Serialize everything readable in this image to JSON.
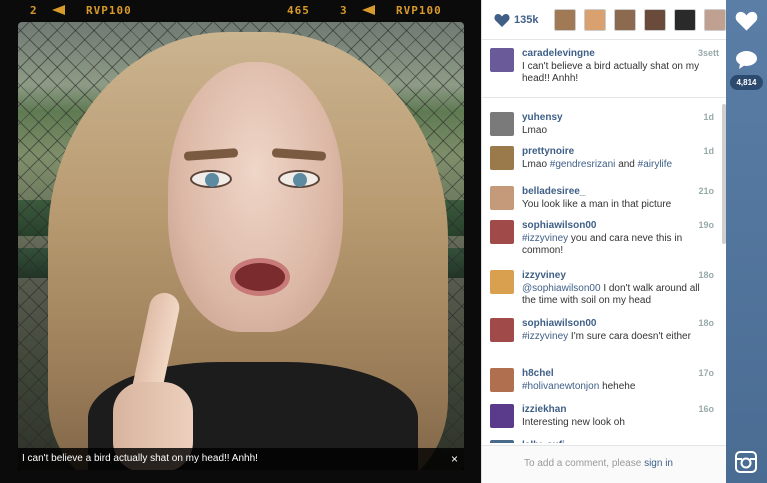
{
  "film_strip": {
    "left_frame": "2",
    "left_brand": "RVP100",
    "center_number": "465",
    "right_frame": "3",
    "right_brand": "RVP100"
  },
  "photo": {
    "caption": "I can't believe a bird actually shat on my head!! Anhh!",
    "close_icon": "×"
  },
  "likes": {
    "count": "135k",
    "liker_colors": [
      "#a07a55",
      "#d9a070",
      "#8b6a50",
      "#6a4a3a",
      "#2a2a2a",
      "#c0a090"
    ]
  },
  "caption_comment": {
    "user": "caradelevingne",
    "time": "3sett",
    "text": "I can't believe a bird actually shat on my head!! Anhh!",
    "avatar_color": "#6a5a9a"
  },
  "comments": [
    {
      "user": "yuhensy",
      "time": "1d",
      "text": "Lmao",
      "avatar_color": "#7a7a7a"
    },
    {
      "user": "prettynoire",
      "time": "1d",
      "text": "Lmao #gendresrizani and #airylife",
      "avatar_color": "#9a7a4a"
    },
    {
      "user": "belladesiree_",
      "time": "21o",
      "text": "You look like a man in that picture",
      "avatar_color": "#c49a7a"
    },
    {
      "user": "sophiawilson00",
      "time": "19o",
      "text": "#izzyviney you and cara neve this in common!",
      "avatar_color": "#a04a4a"
    },
    {
      "user": "izzyviney",
      "time": "18o",
      "text": "@sophiawilson00 I don't walk around all the time with soil on my head",
      "avatar_color": "#d9a050"
    },
    {
      "user": "sophiawilson00",
      "time": "18o",
      "text": "#izzyviney I'm sure cara doesn't either",
      "avatar_color": "#a04a4a"
    },
    {
      "user": "h8chel",
      "time": "17o",
      "text": "#holivanewtonjon hehehe",
      "avatar_color": "#b07050"
    },
    {
      "user": "izziekhan",
      "time": "16o",
      "text": "Interesting new look oh",
      "avatar_color": "#5a3a8a"
    },
    {
      "user": "lally_sufi",
      "time": "",
      "text": "",
      "avatar_color": "#4a6a8a"
    }
  ],
  "add_comment": {
    "prefix": "To add a comment, please",
    "link": "sign in"
  },
  "rail": {
    "comment_count": "4,814"
  }
}
